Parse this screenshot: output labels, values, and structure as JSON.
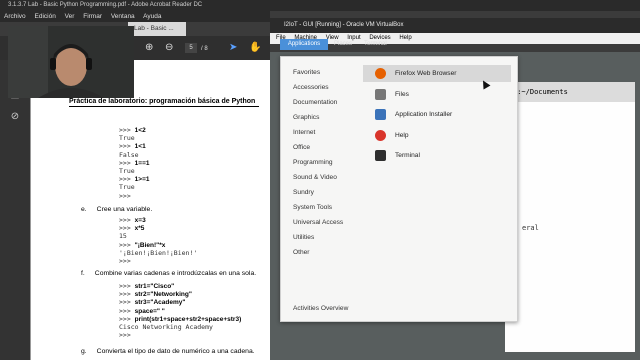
{
  "acrobat": {
    "title": "3.1.3.7 Lab - Basic Python Programming.pdf - Adobe Acrobat Reader DC",
    "menu": [
      "Archivo",
      "Edición",
      "Ver",
      "Firmar",
      "Ventana",
      "Ayuda"
    ],
    "tab_label": "Lab - Basic ...",
    "page_current": "5",
    "page_total": "/ 8",
    "icons": [
      "up-arrow-icon",
      "down-arrow-icon",
      "pointer-icon",
      "hand-icon"
    ]
  },
  "document": {
    "heading": "Práctica de laboratorio: programación básica de Python",
    "block1": [
      {
        "p": ">>> ",
        "b": "1<2"
      },
      {
        "p": "True",
        "b": ""
      },
      {
        "p": ">>> ",
        "b": "1<1"
      },
      {
        "p": "False",
        "b": ""
      },
      {
        "p": ">>> ",
        "b": "1==1"
      },
      {
        "p": "True",
        "b": ""
      },
      {
        "p": ">>> ",
        "b": "1>=1"
      },
      {
        "p": "True",
        "b": ""
      },
      {
        "p": ">>>",
        "b": ""
      }
    ],
    "item_e_letter": "e.",
    "item_e_text": "Cree una variable.",
    "block2": [
      {
        "p": ">>> ",
        "b": "x=3"
      },
      {
        "p": ">>> ",
        "b": "x*5"
      },
      {
        "p": "15",
        "b": ""
      },
      {
        "p": ">>> ",
        "b": "\"¡Bien!\"*x"
      },
      {
        "p": "'¡Bien!¡Bien!¡Bien!'",
        "b": ""
      },
      {
        "p": ">>>",
        "b": ""
      }
    ],
    "item_f_letter": "f.",
    "item_f_text": "Combine varias cadenas e introdúzcalas en una sola.",
    "block3": [
      {
        "p": ">>> ",
        "b": "str1=\"Cisco\""
      },
      {
        "p": ">>> ",
        "b": "str2=\"Networking\""
      },
      {
        "p": ">>> ",
        "b": "str3=\"Academy\""
      },
      {
        "p": ">>> ",
        "b": "space=\" \""
      },
      {
        "p": ">>> ",
        "b": "print(str1+space+str2+space+str3)"
      },
      {
        "p": "Cisco Networking Academy",
        "b": ""
      },
      {
        "p": ">>>",
        "b": ""
      }
    ],
    "item_g_letter": "g.",
    "item_g_text": "Convierta el tipo de dato de numérico a una cadena."
  },
  "virtualbox": {
    "title": "I2IoT - GUI [Running] - Oracle VM VirtualBox",
    "menu": [
      "File",
      "Machine",
      "View",
      "Input",
      "Devices",
      "Help"
    ]
  },
  "gnome": {
    "applications_label": "Applications",
    "places_label": "Places",
    "terminal_label": "Terminal",
    "categories": [
      "Favorites",
      "Accessories",
      "Documentation",
      "Graphics",
      "Internet",
      "Office",
      "Programming",
      "Sound & Video",
      "Sundry",
      "System Tools",
      "Universal Access",
      "Utilities",
      "Other"
    ],
    "apps": [
      {
        "label": "Firefox Web Browser",
        "icon": "firefox-icon",
        "color": "#e66000"
      },
      {
        "label": "Files",
        "icon": "files-icon",
        "color": "#777777"
      },
      {
        "label": "Application Installer",
        "icon": "installer-icon",
        "color": "#3b73b9"
      },
      {
        "label": "Help",
        "icon": "help-icon",
        "color": "#d9352b"
      },
      {
        "label": "Terminal",
        "icon": "terminal-icon",
        "color": "#2e2e2e"
      }
    ],
    "activities_overview": "Activities Overview",
    "terminal_path": "t:~/Documents",
    "terminal_fragment": "eral"
  }
}
